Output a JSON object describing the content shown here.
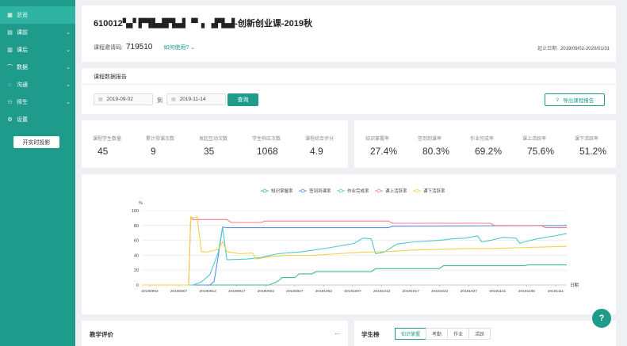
{
  "sidebar": {
    "items": [
      {
        "label": "总览",
        "icon": "grid-icon",
        "glyph": "▦",
        "chevron": false,
        "active": true
      },
      {
        "label": "课前",
        "icon": "book-icon",
        "glyph": "▤",
        "chevron": true,
        "active": false
      },
      {
        "label": "课后",
        "icon": "document-icon",
        "glyph": "▥",
        "chevron": true,
        "active": false
      },
      {
        "label": "数据",
        "icon": "chart-icon",
        "glyph": "⌒",
        "chevron": true,
        "active": false
      },
      {
        "label": "沟通",
        "icon": "chat-icon",
        "glyph": "◌",
        "chevron": true,
        "active": false
      },
      {
        "label": "师生",
        "icon": "people-icon",
        "glyph": "⚇",
        "chevron": true,
        "active": false
      },
      {
        "label": "设置",
        "icon": "gear-icon",
        "glyph": "⚙",
        "chevron": false,
        "active": false
      }
    ],
    "projection_button": "开实时投影"
  },
  "header": {
    "title": "610012▚▞ ▛▜▙▟▛▙▟ ▝▘▖▗▛▙▟-创新创业课-2019秋",
    "invite_label": "课程邀请码:",
    "invite_code": "719510",
    "how_to_use": "如何使用? ⌄",
    "date_label": "起止日期:",
    "date_value": "2019/09/02-2020/01/31"
  },
  "report": {
    "title": "课程数据报告",
    "start_date": "2019-09-02",
    "to_label": "到",
    "end_date": "2019-11-14",
    "query_button": "查询",
    "export_button": "导出课程报告"
  },
  "stats_left": [
    {
      "label": "课程学生数量",
      "value": "45"
    },
    {
      "label": "累计授课次数",
      "value": "9"
    },
    {
      "label": "发起互动次数",
      "value": "35"
    },
    {
      "label": "学生响应次数",
      "value": "1068"
    },
    {
      "label": "课程综合评分",
      "value": "4.9"
    }
  ],
  "stats_right": [
    {
      "label": "知识掌握率",
      "value": "27.4%"
    },
    {
      "label": "签到到课率",
      "value": "80.3%"
    },
    {
      "label": "作业完成率",
      "value": "69.2%"
    },
    {
      "label": "课上活跃率",
      "value": "75.6%"
    },
    {
      "label": "课下活跃率",
      "value": "51.2%"
    }
  ],
  "chart_data": {
    "type": "line",
    "ylabel": "%",
    "xlabel": "日期",
    "ylim": [
      0,
      100
    ],
    "yticks": [
      "0",
      "20",
      "40",
      "60",
      "80",
      "100"
    ],
    "xticks": [
      "20190902",
      "20190907",
      "20190912",
      "20190917",
      "20190922",
      "20190927",
      "20191002",
      "20191007",
      "20191012",
      "20191017",
      "20191022",
      "20191027",
      "20191101",
      "20191106",
      "20191111"
    ],
    "legend_position": "top",
    "grid": true,
    "series": [
      {
        "name": "知识掌握率",
        "color": "#3cbf8c",
        "points": [
          [
            0,
            0
          ],
          [
            25,
            0
          ],
          [
            30,
            0
          ],
          [
            32,
            5
          ],
          [
            33,
            10
          ],
          [
            36,
            10
          ],
          [
            37,
            15
          ],
          [
            40,
            15
          ],
          [
            41,
            18
          ],
          [
            54,
            18
          ],
          [
            55,
            22
          ],
          [
            70,
            22
          ],
          [
            71,
            26
          ],
          [
            90,
            26
          ],
          [
            91,
            27
          ],
          [
            95,
            27
          ],
          [
            100,
            27
          ]
        ]
      },
      {
        "name": "签到到课率",
        "color": "#5a8fe0",
        "points": [
          [
            0,
            0
          ],
          [
            16,
            0
          ],
          [
            17,
            5
          ],
          [
            18,
            40
          ],
          [
            19,
            78
          ],
          [
            20,
            77
          ],
          [
            58,
            77
          ],
          [
            59,
            79
          ],
          [
            100,
            80
          ]
        ]
      },
      {
        "name": "作业完成率",
        "color": "#4cc9d0",
        "points": [
          [
            0,
            0
          ],
          [
            12,
            0
          ],
          [
            14,
            4
          ],
          [
            16,
            14
          ],
          [
            18,
            44
          ],
          [
            19,
            78
          ],
          [
            20,
            34
          ],
          [
            25,
            35
          ],
          [
            28,
            37
          ],
          [
            32,
            42
          ],
          [
            38,
            45
          ],
          [
            44,
            50
          ],
          [
            50,
            56
          ],
          [
            52,
            63
          ],
          [
            54,
            62
          ],
          [
            55,
            42
          ],
          [
            57,
            44
          ],
          [
            60,
            55
          ],
          [
            64,
            58
          ],
          [
            70,
            60
          ],
          [
            73,
            62
          ],
          [
            76,
            63
          ],
          [
            79,
            66
          ],
          [
            80,
            58
          ],
          [
            82,
            60
          ],
          [
            85,
            64
          ],
          [
            88,
            63
          ],
          [
            89,
            56
          ],
          [
            90,
            58
          ],
          [
            93,
            62
          ],
          [
            97,
            66
          ],
          [
            100,
            69
          ]
        ]
      },
      {
        "name": "课上活跃率",
        "color": "#f07e95",
        "points": [
          [
            0,
            0
          ],
          [
            11,
            0
          ],
          [
            11.5,
            90
          ],
          [
            12,
            88
          ],
          [
            20,
            88
          ],
          [
            21,
            84
          ],
          [
            28,
            84
          ],
          [
            29,
            86
          ],
          [
            58,
            86
          ],
          [
            59,
            83
          ],
          [
            82,
            83
          ],
          [
            83,
            80
          ],
          [
            94,
            80
          ],
          [
            95,
            77
          ],
          [
            100,
            77
          ]
        ]
      },
      {
        "name": "课下活跃率",
        "color": "#f2d24a",
        "points": [
          [
            0,
            0
          ],
          [
            11,
            0
          ],
          [
            11.5,
            92
          ],
          [
            12,
            90
          ],
          [
            13,
            92
          ],
          [
            14,
            45
          ],
          [
            15,
            44
          ],
          [
            18,
            48
          ],
          [
            19,
            58
          ],
          [
            20,
            45
          ],
          [
            23,
            42
          ],
          [
            26,
            43
          ],
          [
            27,
            35
          ],
          [
            30,
            38
          ],
          [
            34,
            40
          ],
          [
            40,
            40
          ],
          [
            46,
            42
          ],
          [
            52,
            44
          ],
          [
            58,
            45
          ],
          [
            64,
            47
          ],
          [
            70,
            48
          ],
          [
            76,
            49
          ],
          [
            82,
            49
          ],
          [
            88,
            50
          ],
          [
            94,
            51
          ],
          [
            100,
            52
          ]
        ]
      }
    ]
  },
  "bottom": {
    "eval_title": "教学评价",
    "eval_more": "...",
    "rank_title": "学生榜",
    "tabs": [
      "知识掌握",
      "考勤",
      "作业",
      "活跃"
    ]
  },
  "help_fab": "?"
}
